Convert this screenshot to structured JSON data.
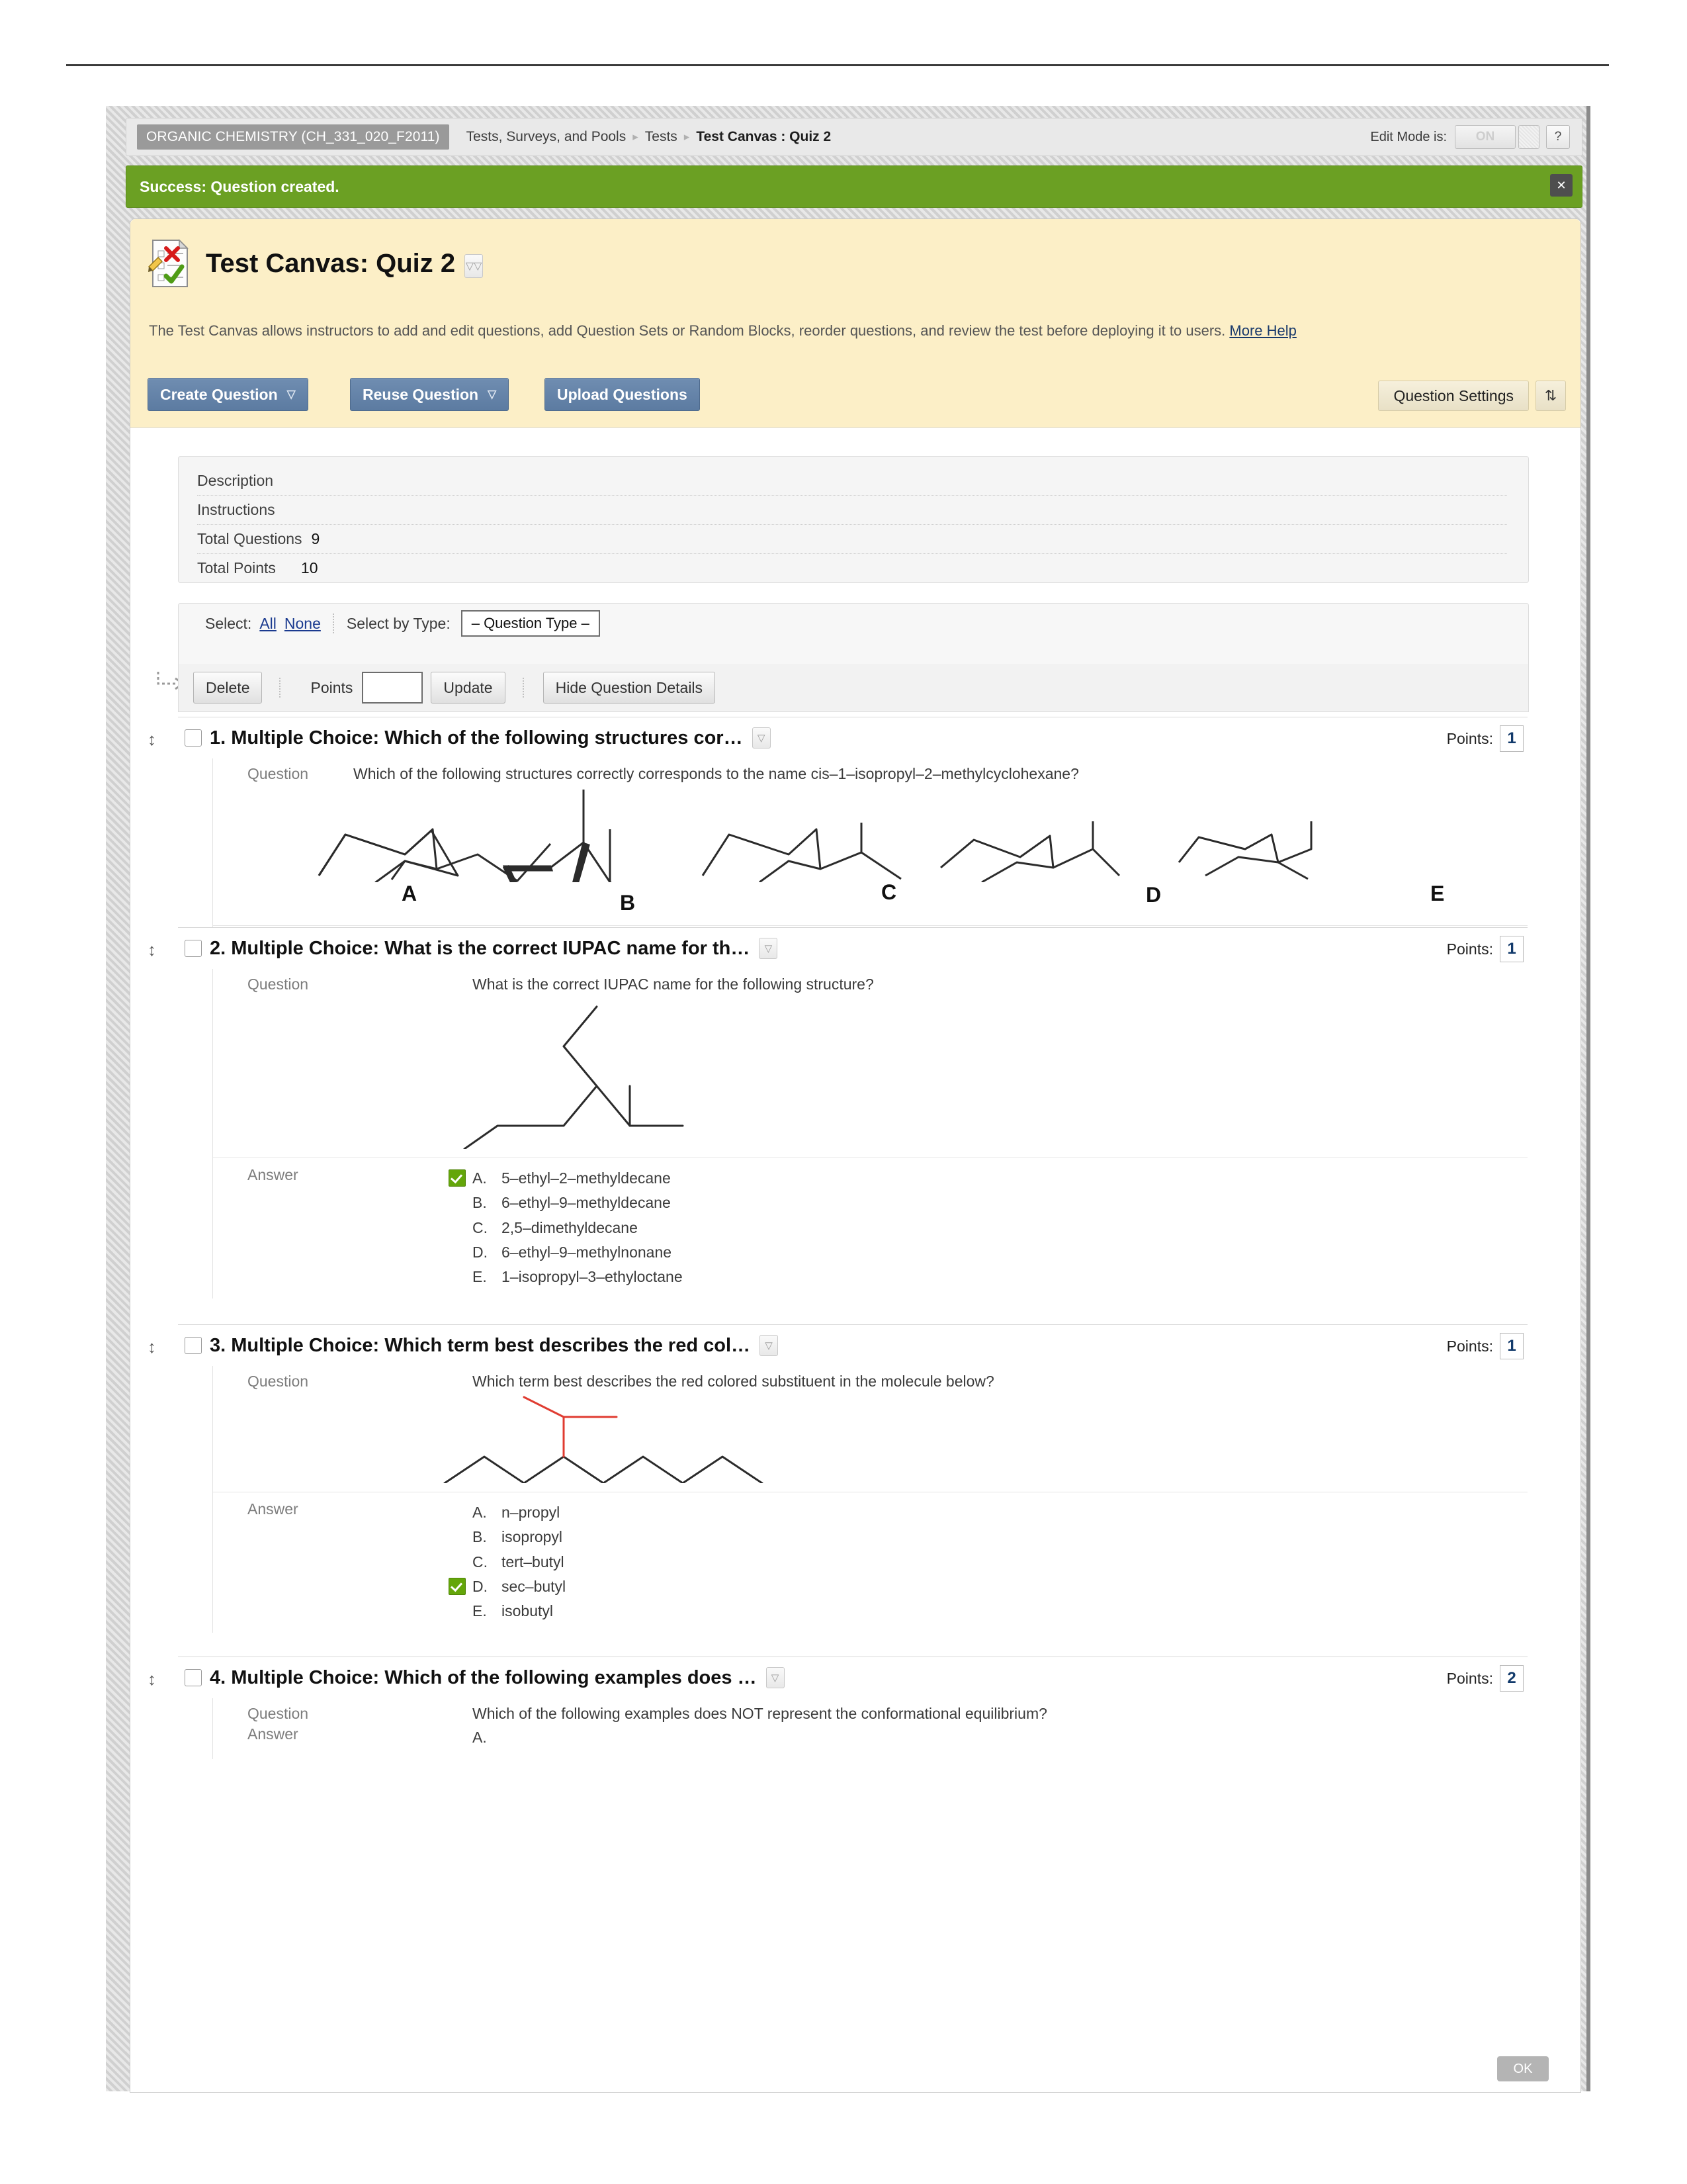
{
  "breadcrumb": {
    "course_pill": "ORGANIC CHEMISTRY (CH_331_020_F2011)",
    "crumb1": "Tests, Surveys, and Pools",
    "crumb2": "Tests",
    "crumb3": "Test Canvas : Quiz 2",
    "edit_mode_label": "Edit Mode is:",
    "edit_mode_value": "ON",
    "help_label": "?"
  },
  "banner": {
    "message": "Success: Question created.",
    "close_label": "✕",
    "color": "#6ba023"
  },
  "header": {
    "title": "Test Canvas: Quiz 2",
    "description": "The Test Canvas allows instructors to add and edit questions, add Question Sets or Random Blocks, reorder questions, and review the test before deploying it to users.",
    "more_help": "More Help"
  },
  "toolbar": {
    "create_question": "Create Question",
    "reuse_question": "Reuse Question",
    "upload_questions": "Upload Questions",
    "question_settings": "Question Settings",
    "sort_icon": "sort-arrows-icon"
  },
  "info": {
    "rows": [
      {
        "label": "Description",
        "value": ""
      },
      {
        "label": "Instructions",
        "value": ""
      },
      {
        "label": "Total Questions",
        "value": "9"
      },
      {
        "label": "Total Points",
        "value": "10"
      }
    ]
  },
  "select_bar": {
    "select_label": "Select:",
    "all": "All",
    "none": "None",
    "by_type_label": "Select by Type:",
    "type_value": "– Question Type –"
  },
  "action_bar": {
    "delete": "Delete",
    "points_label": "Points",
    "points_value": "",
    "update": "Update",
    "hide_details": "Hide Question Details"
  },
  "points_label": "Points:",
  "labels": {
    "question": "Question",
    "answer": "Answer"
  },
  "questions": [
    {
      "number": "1.",
      "title": "1. Multiple Choice: Which of the following structures cor…",
      "points": "1",
      "question_text": "Which of the following structures correctly corresponds to the name cis–1–isopropyl–2–methylcyclohexane?",
      "figure_letters": [
        "A",
        "B",
        "C",
        "D",
        "E"
      ],
      "answers": [
        {
          "alpha": "A.",
          "text": "",
          "correct": false
        },
        {
          "alpha": "B.",
          "text": "",
          "correct": false
        },
        {
          "alpha": "C.",
          "text": "",
          "correct": false
        },
        {
          "alpha": "D.",
          "text": "",
          "correct": false
        },
        {
          "alpha": "E.",
          "text": "",
          "correct": true
        }
      ]
    },
    {
      "number": "2.",
      "title": "2. Multiple Choice: What is the correct IUPAC name for th…",
      "points": "1",
      "question_text": "What is the correct IUPAC name for the following structure?",
      "answers": [
        {
          "alpha": "A.",
          "text": "5–ethyl–2–methyldecane",
          "correct": true
        },
        {
          "alpha": "B.",
          "text": "6–ethyl–9–methyldecane",
          "correct": false
        },
        {
          "alpha": "C.",
          "text": "2,5–dimethyldecane",
          "correct": false
        },
        {
          "alpha": "D.",
          "text": "6–ethyl–9–methylnonane",
          "correct": false
        },
        {
          "alpha": "E.",
          "text": "1–isopropyl–3–ethyloctane",
          "correct": false
        }
      ]
    },
    {
      "number": "3.",
      "title": "3. Multiple Choice: Which term best describes the red col…",
      "points": "1",
      "question_text": "Which term best describes the red colored substituent in the molecule below?",
      "answers": [
        {
          "alpha": "A.",
          "text": "n–propyl",
          "correct": false
        },
        {
          "alpha": "B.",
          "text": "isopropyl",
          "correct": false
        },
        {
          "alpha": "C.",
          "text": "tert–butyl",
          "correct": false
        },
        {
          "alpha": "D.",
          "text": "sec–butyl",
          "correct": true
        },
        {
          "alpha": "E.",
          "text": "isobutyl",
          "correct": false
        }
      ]
    },
    {
      "number": "4.",
      "title": "4. Multiple Choice: Which of the following examples does …",
      "points": "2",
      "question_text": "Which of the following examples does NOT represent the conformational equilibrium?",
      "answers": [
        {
          "alpha": "A.",
          "text": "",
          "correct": false
        }
      ]
    }
  ],
  "footer": {
    "ok": "OK"
  }
}
